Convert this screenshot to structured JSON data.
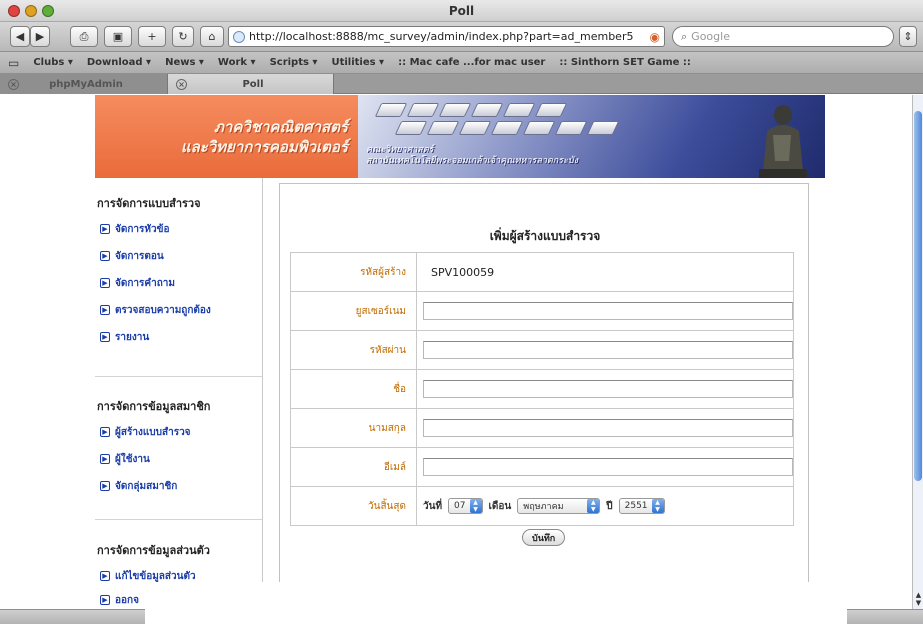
{
  "window": {
    "title": "Poll"
  },
  "toolbar": {
    "url": "http://localhost:8888/mc_survey/admin/index.php?part=ad_member5",
    "search_placeholder": "Google"
  },
  "bookmarks": [
    "Clubs ▾",
    "Download ▾",
    "News ▾",
    "Work ▾",
    "Scripts ▾",
    "Utilities ▾",
    ":: Mac cafe ...for mac user",
    ":: Sinthorn SET Game ::"
  ],
  "tabs": [
    {
      "label": "phpMyAdmin",
      "active": false
    },
    {
      "label": "Poll",
      "active": true
    }
  ],
  "banner": {
    "title_line1": "ภาควิชาคณิตศาสตร์",
    "title_line2": "และวิทยาการคอมพิวเตอร์",
    "caption_line1": "คณะวิทยาศาสตร์",
    "caption_line2": "สถาบันเทคโนโลยีพระจอมเกล้าเจ้าคุณทหารลาดกระบัง"
  },
  "sidebar": {
    "groups": [
      {
        "heading": "การจัดการแบบสำรวจ",
        "items": [
          "จัดการหัวข้อ",
          "จัดการตอน",
          "จัดการคำถาม",
          "ตรวจสอบความถูกต้อง",
          "รายงาน"
        ]
      },
      {
        "heading": "การจัดการข้อมูลสมาชิก",
        "items": [
          "ผู้สร้างแบบสำรวจ",
          "ผู้ใช้งาน",
          "จัดกลุ่มสมาชิก"
        ]
      },
      {
        "heading": "การจัดการข้อมูลส่วนตัว",
        "items": [
          "แก้ไขข้อมูลส่วนตัว",
          "ออกจ"
        ]
      }
    ]
  },
  "form": {
    "title": "เพิ่มผู้สร้างแบบสำรวจ",
    "fields": [
      {
        "label": "รหัสผู้สร้าง",
        "value": "SPV100059"
      },
      {
        "label": "ยูสเซอร์เนม",
        "value": ""
      },
      {
        "label": "รหัสผ่าน",
        "value": ""
      },
      {
        "label": "ชื่อ",
        "value": ""
      },
      {
        "label": "นามสกุล",
        "value": ""
      },
      {
        "label": "อีเมล์",
        "value": ""
      }
    ],
    "expiry": {
      "label": "วันสิ้นสุด",
      "day_label": "วันที่",
      "day": "07",
      "month_label": "เดือน",
      "month": "พฤษภาคม",
      "year_label": "ปี",
      "year": "2551"
    },
    "save_label": "บันทึก"
  }
}
